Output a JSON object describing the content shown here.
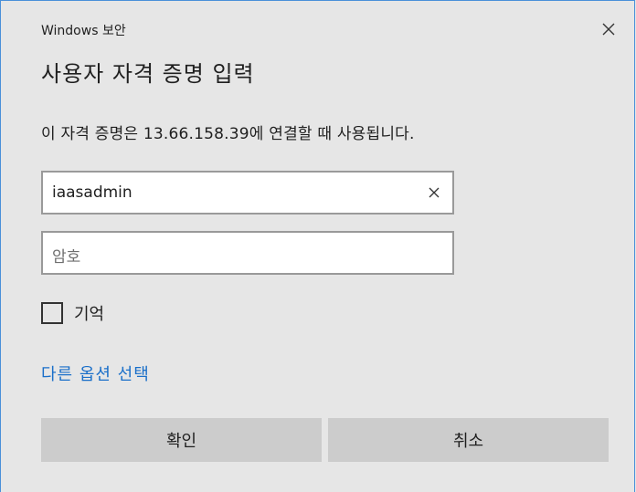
{
  "window": {
    "title": "Windows 보안"
  },
  "dialog": {
    "heading": "사용자 자격 증명 입력",
    "description": "이 자격 증명은 13.66.158.39에 연결할 때 사용됩니다."
  },
  "username": {
    "value": "iaasadmin"
  },
  "password": {
    "placeholder": "암호"
  },
  "remember": {
    "label": "기억",
    "checked": false
  },
  "links": {
    "more_options": "다른 옵션 선택"
  },
  "buttons": {
    "ok": "확인",
    "cancel": "취소"
  },
  "colors": {
    "accent_link": "#1a6fc9",
    "background": "#e6e6e6",
    "button": "#cccccc",
    "window_border": "#4a90d9"
  },
  "icons": {
    "close": "close-icon",
    "clear": "clear-icon",
    "checkbox": "checkbox-unchecked"
  }
}
